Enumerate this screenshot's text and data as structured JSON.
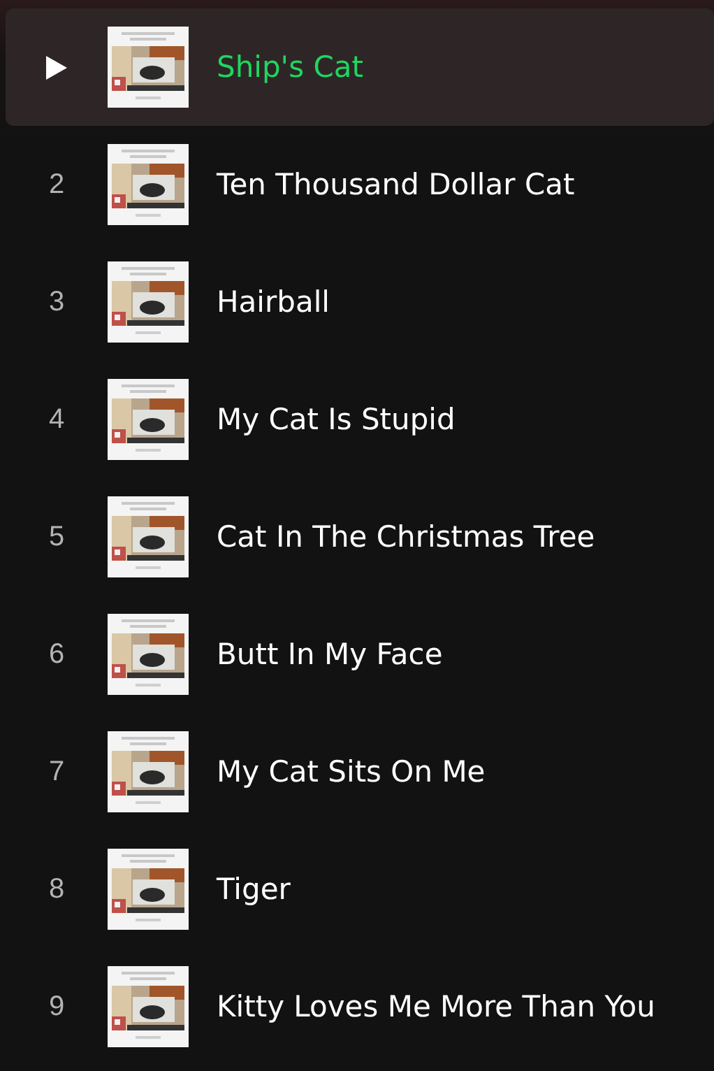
{
  "tracks": [
    {
      "title": "Ship's Cat",
      "selected": true
    },
    {
      "number": "2",
      "title": "Ten Thousand Dollar Cat",
      "selected": false
    },
    {
      "number": "3",
      "title": "Hairball",
      "selected": false
    },
    {
      "number": "4",
      "title": "My Cat Is Stupid",
      "selected": false
    },
    {
      "number": "5",
      "title": "Cat In The Christmas Tree",
      "selected": false
    },
    {
      "number": "6",
      "title": "Butt In My Face",
      "selected": false
    },
    {
      "number": "7",
      "title": "My Cat Sits On Me",
      "selected": false
    },
    {
      "number": "8",
      "title": "Tiger",
      "selected": false
    },
    {
      "number": "9",
      "title": "Kitty Loves Me More Than You",
      "selected": false
    }
  ]
}
